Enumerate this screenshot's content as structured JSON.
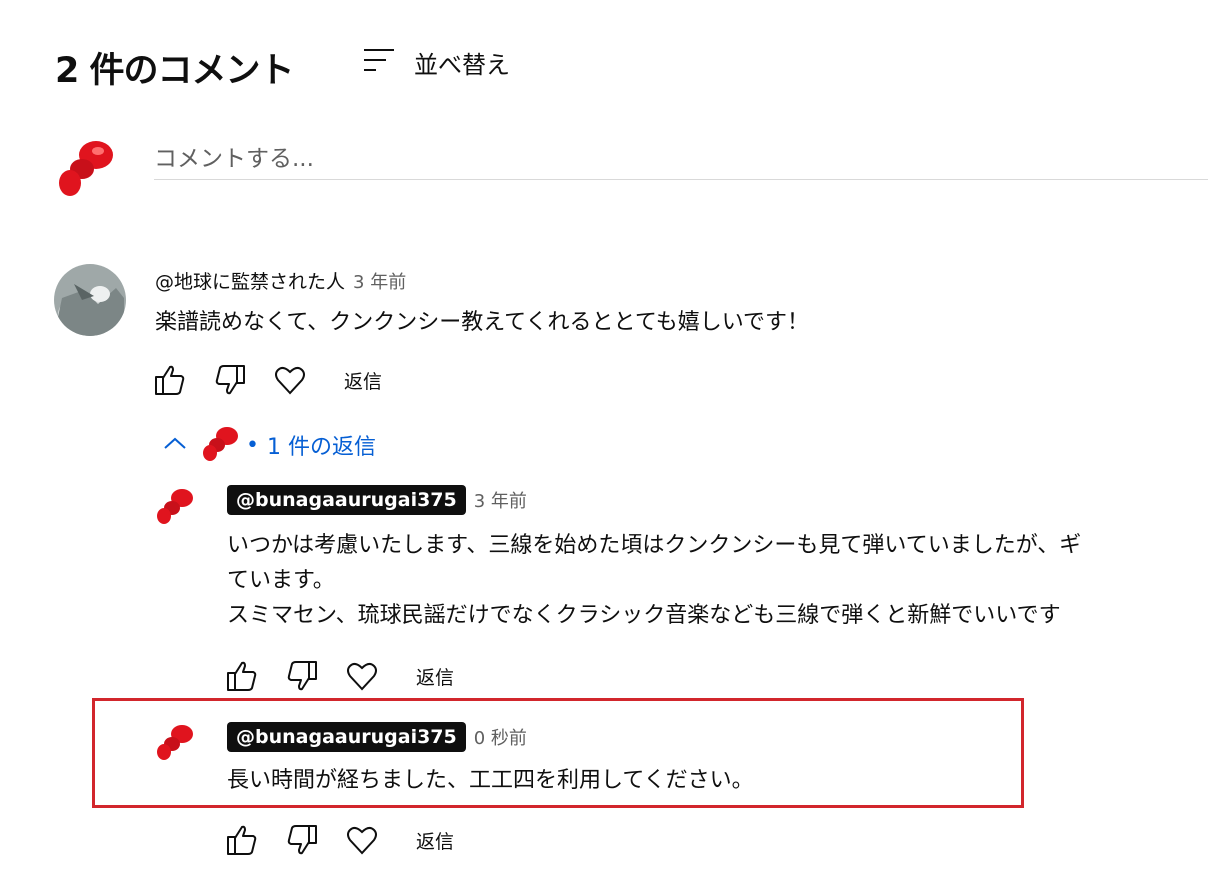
{
  "header": {
    "comment_count_title": "2 件のコメント",
    "sort_label": "並べ替え"
  },
  "add_comment": {
    "placeholder": "コメントする..."
  },
  "comments": [
    {
      "author": "@地球に監禁された人",
      "time": "3 年前",
      "text": "楽譜読めなくて、クンクンシー教えてくれるととても嬉しいです！",
      "reply_label": "返信"
    }
  ],
  "replies_toggle": {
    "label": "1 件の返信"
  },
  "replies": [
    {
      "author": "@bunagaaurugai375",
      "time": "3 年前",
      "lines": [
        "いつかは考慮いたします、三線を始めた頃はクンクンシーも見て弾いていましたが、ギ",
        "ています。",
        "スミマセン、琉球民謡だけでなくクラシック音楽なども三線で弾くと新鮮でいいです"
      ],
      "reply_label": "返信"
    },
    {
      "author": "@bunagaaurugai375",
      "time": "0 秒前",
      "text": "長い時間が経ちました、工工四を利用してください。",
      "reply_label": "返信"
    }
  ],
  "colors": {
    "link_blue": "#065fd4",
    "highlight_red": "#d2262c",
    "avatar_red": "#e0141e"
  },
  "icons": [
    "sort-icon",
    "like-icon",
    "dislike-icon",
    "heart-icon",
    "chevron-up-icon"
  ]
}
